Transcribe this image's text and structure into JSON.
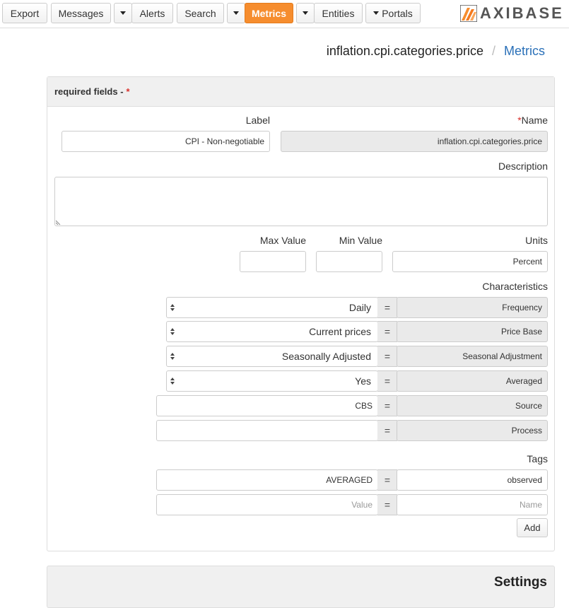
{
  "nav": {
    "export": "Export",
    "messages": "Messages",
    "alerts": "Alerts",
    "search": "Search",
    "metrics": "Metrics",
    "entities": "Entities",
    "portals": "Portals"
  },
  "logo": {
    "text": "AXIBASE"
  },
  "breadcrumb": {
    "current": "inflation.cpi.categories.price",
    "separator": "/",
    "link": "Metrics"
  },
  "form": {
    "header": "required fields -",
    "required_marker": "*",
    "label_label": "Label",
    "label_value": "CPI - Non-negotiable",
    "name_star": "*",
    "name_label": "Name",
    "name_value": "inflation.cpi.categories.price",
    "description_label": "Description",
    "description_value": "",
    "max_value_label": "Max Value",
    "max_value": "",
    "min_value_label": "Min Value",
    "min_value": "",
    "units_label": "Units",
    "units_value": "Percent",
    "characteristics_label": "Characteristics",
    "characteristics": [
      {
        "value": "Daily",
        "name": "Frequency"
      },
      {
        "value": "Current prices",
        "name": "Price Base"
      },
      {
        "value": "Seasonally Adjusted",
        "name": "Seasonal Adjustment"
      },
      {
        "value": "Yes",
        "name": "Averaged"
      },
      {
        "value": "CBS",
        "name": "Source"
      },
      {
        "value": "",
        "name": "Process"
      }
    ],
    "equals": "=",
    "tags_label": "Tags",
    "tags": [
      {
        "value": "AVERAGED",
        "name": "observed"
      }
    ],
    "new_tag": {
      "value_placeholder": "Value",
      "name_placeholder": "Name"
    },
    "add_button": "Add"
  },
  "settings": {
    "title": "Settings"
  },
  "colors": {
    "active_nav": "#f68d2e",
    "link": "#2a70b8",
    "required": "#d9302b"
  }
}
